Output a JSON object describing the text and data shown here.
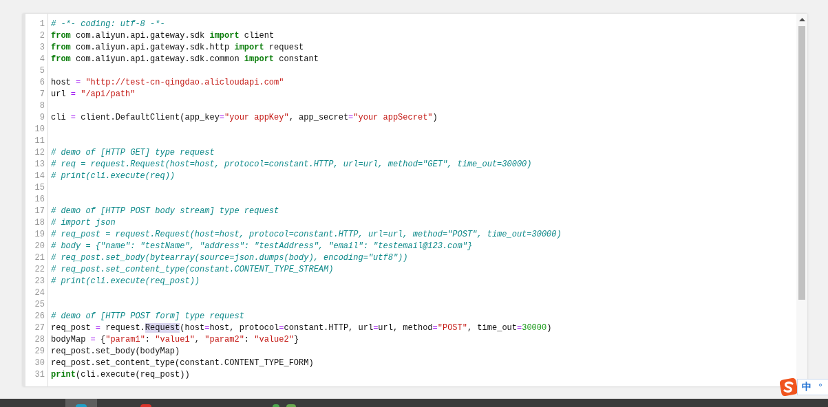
{
  "editor": {
    "lines": [
      {
        "number": "1",
        "tokens": [
          {
            "kind": "comment",
            "text": "# -*- coding: utf-8 -*-"
          }
        ]
      },
      {
        "number": "2",
        "tokens": [
          {
            "kind": "keyword",
            "text": "from"
          },
          {
            "kind": "plain",
            "text": " com.aliyun.api.gateway.sdk "
          },
          {
            "kind": "keyword",
            "text": "import"
          },
          {
            "kind": "plain",
            "text": " client"
          }
        ]
      },
      {
        "number": "3",
        "tokens": [
          {
            "kind": "keyword",
            "text": "from"
          },
          {
            "kind": "plain",
            "text": " com.aliyun.api.gateway.sdk.http "
          },
          {
            "kind": "keyword",
            "text": "import"
          },
          {
            "kind": "plain",
            "text": " request"
          }
        ]
      },
      {
        "number": "4",
        "tokens": [
          {
            "kind": "keyword",
            "text": "from"
          },
          {
            "kind": "plain",
            "text": " com.aliyun.api.gateway.sdk.common "
          },
          {
            "kind": "keyword",
            "text": "import"
          },
          {
            "kind": "plain",
            "text": " constant"
          }
        ]
      },
      {
        "number": "5"
      },
      {
        "number": "6",
        "tokens": [
          {
            "kind": "plain",
            "text": "host "
          },
          {
            "kind": "operator",
            "text": "="
          },
          {
            "kind": "string",
            "text": " \"http://test-cn-qingdao.alicloudapi.com\""
          }
        ]
      },
      {
        "number": "7",
        "tokens": [
          {
            "kind": "plain",
            "text": "url "
          },
          {
            "kind": "operator",
            "text": "="
          },
          {
            "kind": "string",
            "text": " \"/api/path\""
          }
        ]
      },
      {
        "number": "8"
      },
      {
        "number": "9",
        "tokens": [
          {
            "kind": "plain",
            "text": "cli "
          },
          {
            "kind": "operator",
            "text": "="
          },
          {
            "kind": "plain",
            "text": " client.DefaultClient(app_key"
          },
          {
            "kind": "operator",
            "text": "="
          },
          {
            "kind": "string",
            "text": "\"your appKey\""
          },
          {
            "kind": "plain",
            "text": ", app_secret"
          },
          {
            "kind": "operator",
            "text": "="
          },
          {
            "kind": "string",
            "text": "\"your appSecret\""
          },
          {
            "kind": "plain",
            "text": ")"
          }
        ]
      },
      {
        "number": "10"
      },
      {
        "number": "11"
      },
      {
        "number": "12",
        "tokens": [
          {
            "kind": "comment",
            "text": "# demo of [HTTP GET] type request"
          }
        ]
      },
      {
        "number": "13",
        "tokens": [
          {
            "kind": "comment",
            "text": "# req = request.Request(host=host, protocol=constant.HTTP, url=url, method=\"GET\", time_out=30000)"
          }
        ]
      },
      {
        "number": "14",
        "tokens": [
          {
            "kind": "comment",
            "text": "# print(cli.execute(req))"
          }
        ]
      },
      {
        "number": "15"
      },
      {
        "number": "16"
      },
      {
        "number": "17",
        "tokens": [
          {
            "kind": "comment",
            "text": "# demo of [HTTP POST body stream] type request"
          }
        ]
      },
      {
        "number": "18",
        "tokens": [
          {
            "kind": "comment",
            "text": "# import json"
          }
        ]
      },
      {
        "number": "19",
        "tokens": [
          {
            "kind": "comment",
            "text": "# req_post = request.Request(host=host, protocol=constant.HTTP, url=url, method=\"POST\", time_out=30000)"
          }
        ]
      },
      {
        "number": "20",
        "tokens": [
          {
            "kind": "comment",
            "text": "# body = {\"name\": \"testName\", \"address\": \"testAddress\", \"email\": \"testemail@123.com\"}"
          }
        ]
      },
      {
        "number": "21",
        "tokens": [
          {
            "kind": "comment",
            "text": "# req_post.set_body(bytearray(source=json.dumps(body), encoding=\"utf8\"))"
          }
        ]
      },
      {
        "number": "22",
        "tokens": [
          {
            "kind": "comment",
            "text": "# req_post.set_content_type(constant.CONTENT_TYPE_STREAM)"
          }
        ]
      },
      {
        "number": "23",
        "tokens": [
          {
            "kind": "comment",
            "text": "# print(cli.execute(req_post))"
          }
        ]
      },
      {
        "number": "24"
      },
      {
        "number": "25"
      },
      {
        "number": "26",
        "tokens": [
          {
            "kind": "comment",
            "text": "# demo of [HTTP POST form] type request"
          }
        ]
      },
      {
        "number": "27",
        "tokens": [
          {
            "kind": "plain",
            "text": "req_post "
          },
          {
            "kind": "operator",
            "text": "="
          },
          {
            "kind": "plain",
            "text": " request."
          },
          {
            "kind": "match",
            "text": "Request"
          },
          {
            "kind": "plain",
            "text": "(host"
          },
          {
            "kind": "operator",
            "text": "="
          },
          {
            "kind": "plain",
            "text": "host, protocol"
          },
          {
            "kind": "operator",
            "text": "="
          },
          {
            "kind": "plain",
            "text": "constant.HTTP, url"
          },
          {
            "kind": "operator",
            "text": "="
          },
          {
            "kind": "plain",
            "text": "url, method"
          },
          {
            "kind": "operator",
            "text": "="
          },
          {
            "kind": "string",
            "text": "\"POST\""
          },
          {
            "kind": "plain",
            "text": ", time_out"
          },
          {
            "kind": "operator",
            "text": "="
          },
          {
            "kind": "number",
            "text": "30000"
          },
          {
            "kind": "plain",
            "text": ")"
          }
        ]
      },
      {
        "number": "28",
        "tokens": [
          {
            "kind": "plain",
            "text": "bodyMap "
          },
          {
            "kind": "operator",
            "text": "="
          },
          {
            "kind": "plain",
            "text": " {"
          },
          {
            "kind": "string",
            "text": "\"param1\""
          },
          {
            "kind": "plain",
            "text": ": "
          },
          {
            "kind": "string",
            "text": "\"value1\""
          },
          {
            "kind": "plain",
            "text": ", "
          },
          {
            "kind": "string",
            "text": "\"param2\""
          },
          {
            "kind": "plain",
            "text": ": "
          },
          {
            "kind": "string",
            "text": "\"value2\""
          },
          {
            "kind": "plain",
            "text": "}"
          }
        ]
      },
      {
        "number": "29",
        "tokens": [
          {
            "kind": "plain",
            "text": "req_post.set_body(bodyMap)"
          }
        ]
      },
      {
        "number": "30",
        "tokens": [
          {
            "kind": "plain",
            "text": "req_post.set_content_type(constant.CONTENT_TYPE_FORM)"
          }
        ]
      },
      {
        "number": "31",
        "tokens": [
          {
            "kind": "keyword",
            "text": "print"
          },
          {
            "kind": "plain",
            "text": "(cli.execute(req_post))"
          }
        ]
      }
    ]
  },
  "ime": {
    "mode": "中",
    "indicator": "°"
  }
}
